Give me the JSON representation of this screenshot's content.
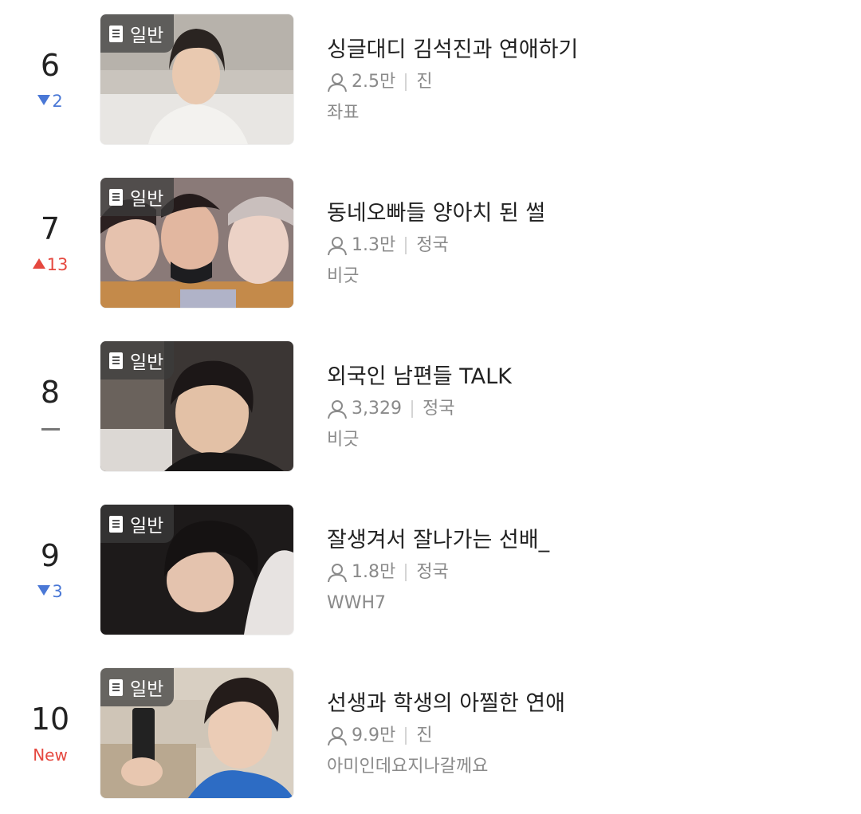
{
  "badge_label": "일반",
  "items": [
    {
      "rank": "6",
      "change": {
        "dir": "down",
        "text": "2"
      },
      "title": "싱글대디 김석진과 연애하기",
      "views": "2.5만",
      "member": "진",
      "author": "좌표"
    },
    {
      "rank": "7",
      "change": {
        "dir": "up",
        "text": "13"
      },
      "title": "동네오빠들 양아치 된 썰",
      "views": "1.3만",
      "member": "정국",
      "author": "비긋"
    },
    {
      "rank": "8",
      "change": {
        "dir": "same",
        "text": ""
      },
      "title": "외국인 남편들 TALK",
      "views": "3,329",
      "member": "정국",
      "author": "비긋"
    },
    {
      "rank": "9",
      "change": {
        "dir": "down",
        "text": "3"
      },
      "title": "잘생겨서 잘나가는 선배_",
      "views": "1.8만",
      "member": "정국",
      "author": "WWH7"
    },
    {
      "rank": "10",
      "change": {
        "dir": "new",
        "text": "New"
      },
      "title": "선생과 학생의 아찔한 연애",
      "views": "9.9만",
      "member": "진",
      "author": "아미인데요지나갈께요"
    }
  ],
  "colors": {
    "rank_down": "#4a78d6",
    "rank_up": "#e5483f",
    "text_primary": "#222222",
    "text_secondary": "#8a8a8a"
  },
  "icons": {
    "badge": "document-icon",
    "views": "user-icon",
    "rank_down": "triangle-down-icon",
    "rank_up": "triangle-up-icon",
    "rank_same": "dash-icon"
  }
}
